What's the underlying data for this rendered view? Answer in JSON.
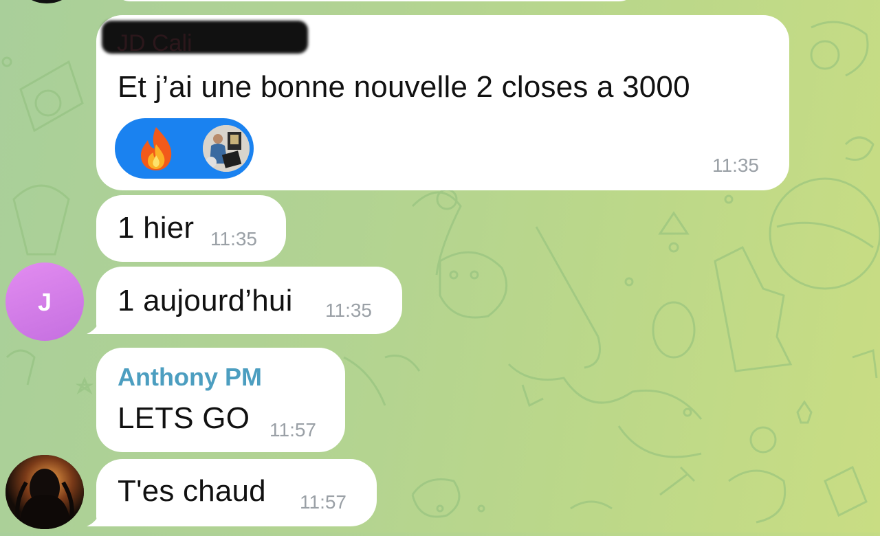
{
  "colors": {
    "reaction_pill": "#1a82f0",
    "avatar_j": "#d47ee8",
    "sender_anthony": "#4c9ec0"
  },
  "messages": [
    {
      "sender": "JD Cali",
      "sender_redacted": true,
      "text": "Et j’ai une bonne nouvelle 2 closes a 3000",
      "time": "11:35",
      "reactions": [
        "fire-emoji",
        "user-photo-reaction"
      ]
    },
    {
      "text": "1 hier",
      "time": "11:35"
    },
    {
      "text": "1 aujourd’hui",
      "time": "11:35",
      "avatar_initial": "J"
    },
    {
      "sender": "Anthony PM",
      "text": "LETS GO",
      "time": "11:57"
    },
    {
      "text": "T'es chaud",
      "time": "11:57",
      "avatar": "profile-photo-avatar"
    }
  ]
}
